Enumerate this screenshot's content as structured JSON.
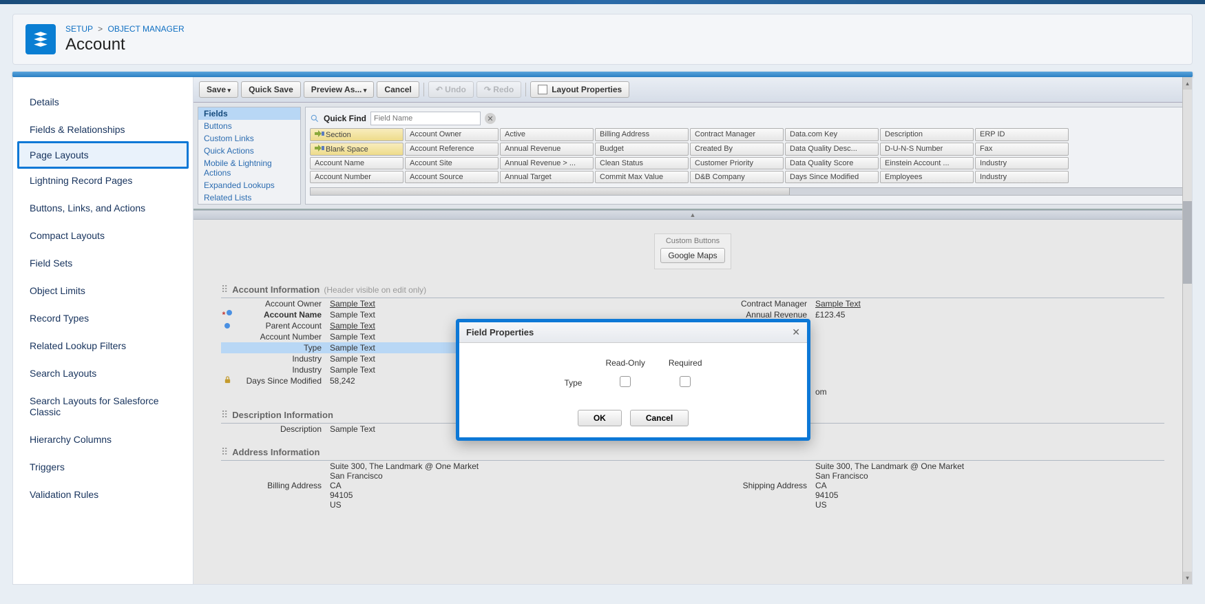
{
  "breadcrumb": {
    "setup": "SETUP",
    "objmgr": "OBJECT MANAGER"
  },
  "page_title": "Account",
  "sidebar": {
    "items": [
      "Details",
      "Fields & Relationships",
      "Page Layouts",
      "Lightning Record Pages",
      "Buttons, Links, and Actions",
      "Compact Layouts",
      "Field Sets",
      "Object Limits",
      "Record Types",
      "Related Lookup Filters",
      "Search Layouts",
      "Search Layouts for Salesforce Classic",
      "Hierarchy Columns",
      "Triggers",
      "Validation Rules"
    ],
    "active_index": 2
  },
  "toolbar": {
    "save": "Save",
    "quick_save": "Quick Save",
    "preview": "Preview As...",
    "cancel": "Cancel",
    "undo": "Undo",
    "redo": "Redo",
    "layout_props": "Layout Properties"
  },
  "palette": {
    "quick_find_label": "Quick Find",
    "quick_find_placeholder": "Field Name",
    "nav": [
      "Fields",
      "Buttons",
      "Custom Links",
      "Quick Actions",
      "Mobile & Lightning Actions",
      "Expanded Lookups",
      "Related Lists"
    ],
    "nav_selected": 0,
    "fields_grid": [
      [
        "Section",
        "Account Owner",
        "Active",
        "Billing Address",
        "Contract Manager",
        "Data.com Key",
        "Description",
        "ERP ID"
      ],
      [
        "Blank Space",
        "Account Reference",
        "Annual Revenue",
        "Budget",
        "Created By",
        "Data Quality Desc...",
        "D-U-N-S Number",
        "Fax"
      ],
      [
        "Account Name",
        "Account Site",
        "Annual Revenue > ...",
        "Clean Status",
        "Customer Priority",
        "Data Quality Score",
        "Einstein Account ...",
        "Industry"
      ],
      [
        "Account Number",
        "Account Source",
        "Annual Target",
        "Commit Max Value",
        "D&B Company",
        "Days Since Modified",
        "Employees",
        "Industry"
      ]
    ]
  },
  "custom_buttons": {
    "label": "Custom Buttons",
    "btn": "Google Maps"
  },
  "sections": {
    "account_info": {
      "title": "Account Information",
      "note": "(Header visible on edit only)",
      "left": [
        {
          "label": "Account Owner",
          "val": "Sample Text",
          "link": true
        },
        {
          "label": "Account Name",
          "val": "Sample Text",
          "req": true,
          "dot": true,
          "bold": true
        },
        {
          "label": "Parent Account",
          "val": "Sample Text",
          "link": true,
          "dot": true
        },
        {
          "label": "Account Number",
          "val": "Sample Text"
        },
        {
          "label": "Type",
          "val": "Sample Text",
          "hilite": true
        },
        {
          "label": "Industry",
          "val": "Sample Text"
        },
        {
          "label": "Industry",
          "val": "Sample Text"
        },
        {
          "label": "Days Since Modified",
          "val": "58,242",
          "lock": true
        }
      ],
      "right": [
        {
          "label": "Contract Manager",
          "val": "Sample Text",
          "link": true
        },
        {
          "label": "Annual Revenue",
          "val": "£123.45"
        },
        {
          "label": "",
          "val": "om",
          "tail": true
        }
      ]
    },
    "desc_info": {
      "title": "Description Information",
      "left": [
        {
          "label": "Description",
          "val": "Sample Text"
        }
      ]
    },
    "addr_info": {
      "title": "Address Information",
      "left": {
        "label": "Billing Address",
        "lines": [
          "Suite 300, The Landmark @ One Market",
          "San Francisco",
          "CA",
          "94105",
          "US"
        ]
      },
      "right": {
        "label": "Shipping Address",
        "lines": [
          "Suite 300, The Landmark @ One Market",
          "San Francisco",
          "CA",
          "94105",
          "US"
        ]
      }
    }
  },
  "modal": {
    "title": "Field Properties",
    "col1": "Read-Only",
    "col2": "Required",
    "field_label": "Type",
    "ok": "OK",
    "cancel": "Cancel"
  }
}
